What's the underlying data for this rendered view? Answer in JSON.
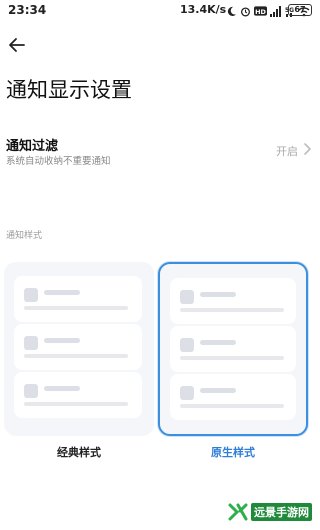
{
  "status_bar": {
    "time": "23:34",
    "network_speed": "13.4K/s",
    "battery": "67",
    "icons": [
      "moon-icon",
      "alarm-icon",
      "hd-icon",
      "signal-icon",
      "5g-icon",
      "signal-icon",
      "wifi-icon"
    ]
  },
  "header": {
    "title": "通知显示设置"
  },
  "notification_filter": {
    "title": "通知过滤",
    "description": "系统自动收纳不重要通知",
    "value": "开启"
  },
  "style_section": {
    "label": "通知样式",
    "options": [
      {
        "label": "经典样式",
        "selected": false
      },
      {
        "label": "原生样式",
        "selected": true
      }
    ]
  },
  "watermark": {
    "text": "远景手游网"
  },
  "colors": {
    "accent": "#3b8ee0",
    "selected_label": "#2f7fd8",
    "card_bg": "#f4f6fa",
    "watermark": "#1f8a3a"
  }
}
